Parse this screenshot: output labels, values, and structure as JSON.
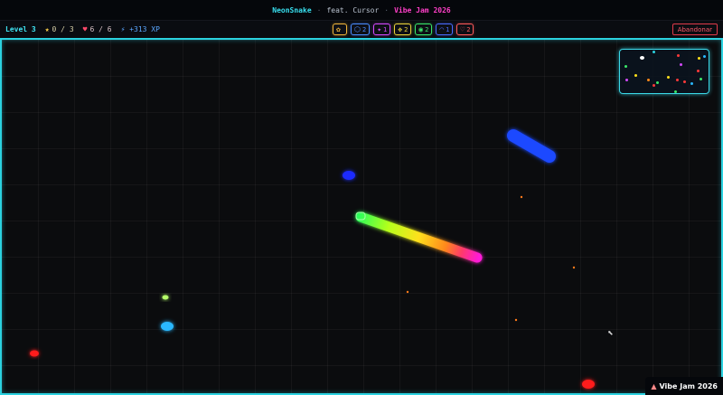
{
  "header": {
    "brand": "NeonSnake",
    "separator1": "·",
    "feat": "feat. Cursor",
    "separator2": "·",
    "jam": "Vibe Jam 2026"
  },
  "hud": {
    "level": "Level 3",
    "stars": "0 / 3",
    "lives": "6 / 6",
    "xp": "+313 XP",
    "abandon": "Abandonar",
    "powerups": [
      {
        "name": "palette",
        "glyph": "✿",
        "count": "",
        "color": "#f0b43a"
      },
      {
        "name": "shield",
        "glyph": "⬡",
        "count": "2",
        "color": "#4a8cff"
      },
      {
        "name": "sparkle",
        "glyph": "✦",
        "count": "1",
        "color": "#d44aff"
      },
      {
        "name": "multi",
        "glyph": "✥",
        "count": "2",
        "color": "#e8d23a"
      },
      {
        "name": "magnet",
        "glyph": "◉",
        "count": "2",
        "color": "#3ae86a"
      },
      {
        "name": "arc",
        "glyph": "◠",
        "count": "1",
        "color": "#4a6cff"
      },
      {
        "name": "heart",
        "glyph": "♡",
        "count": "2",
        "color": "#ff5a5a"
      }
    ]
  },
  "footer": {
    "badge": "Vibe Jam 2026"
  },
  "colors": {
    "accent": "#2bd2e0",
    "brand": "#38e0f0",
    "jam": "#ff3fc8",
    "danger": "#e03a4a"
  }
}
